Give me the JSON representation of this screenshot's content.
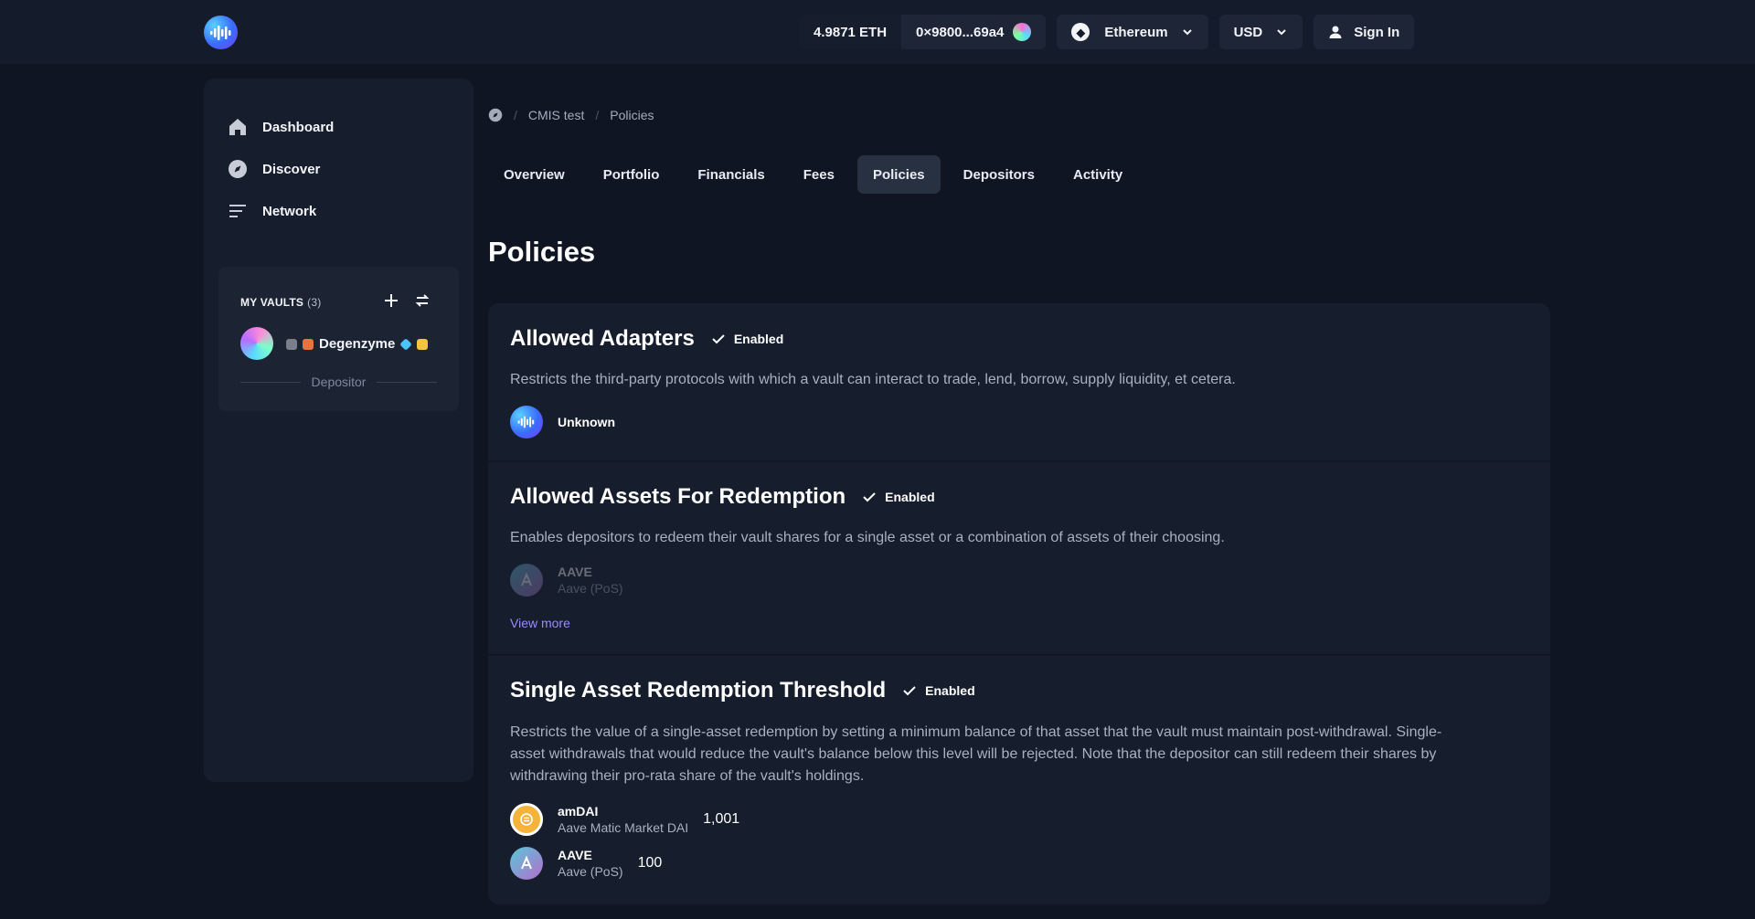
{
  "header": {
    "balance": "4.9871 ETH",
    "address": "0×9800...69a4",
    "network": "Ethereum",
    "currency": "USD",
    "sign_in": "Sign In"
  },
  "sidebar": {
    "items": [
      {
        "label": "Dashboard",
        "icon": "home-icon"
      },
      {
        "label": "Discover",
        "icon": "compass-icon"
      },
      {
        "label": "Network",
        "icon": "list-icon"
      }
    ],
    "vaults": {
      "title": "MY VAULTS",
      "count": "(3)",
      "vault_name": "Degenzyme",
      "role": "Depositor"
    }
  },
  "breadcrumb": {
    "items": [
      "CMIS test",
      "Policies"
    ]
  },
  "tabs": [
    "Overview",
    "Portfolio",
    "Financials",
    "Fees",
    "Policies",
    "Depositors",
    "Activity"
  ],
  "active_tab": "Policies",
  "page_title": "Policies",
  "policies": [
    {
      "title": "Allowed Adapters",
      "status": "Enabled",
      "description": "Restricts the third-party protocols with which a vault can interact to trade, lend, borrow, supply liquidity, et cetera.",
      "assets": [
        {
          "name": "Unknown"
        }
      ]
    },
    {
      "title": "Allowed Assets For Redemption",
      "status": "Enabled",
      "description": "Enables depositors to redeem their vault shares for a single asset or a combination of assets of their choosing.",
      "assets": [
        {
          "name": "AAVE",
          "sub": "Aave (PoS)"
        }
      ],
      "view_more": "View more"
    },
    {
      "title": "Single Asset Redemption Threshold",
      "status": "Enabled",
      "description_lines": [
        "Restricts the value of a single-asset redemption by setting a minimum balance of that asset that the vault must maintain post-withdrawal. Single-",
        "asset withdrawals that would reduce the vault's balance below this level will be rejected. Note that the depositor can still redeem their shares by",
        "withdrawing their pro-rata share of the vault's holdings."
      ],
      "assets": [
        {
          "name": "amDAI",
          "sub": "Aave Matic Market DAI",
          "value": "1,001"
        },
        {
          "name": "AAVE",
          "sub": "Aave (PoS)",
          "value": "100"
        }
      ]
    }
  ],
  "colors": {
    "background": "#0f1523",
    "panel": "#161d2c",
    "accent_link": "#9a8cff"
  }
}
